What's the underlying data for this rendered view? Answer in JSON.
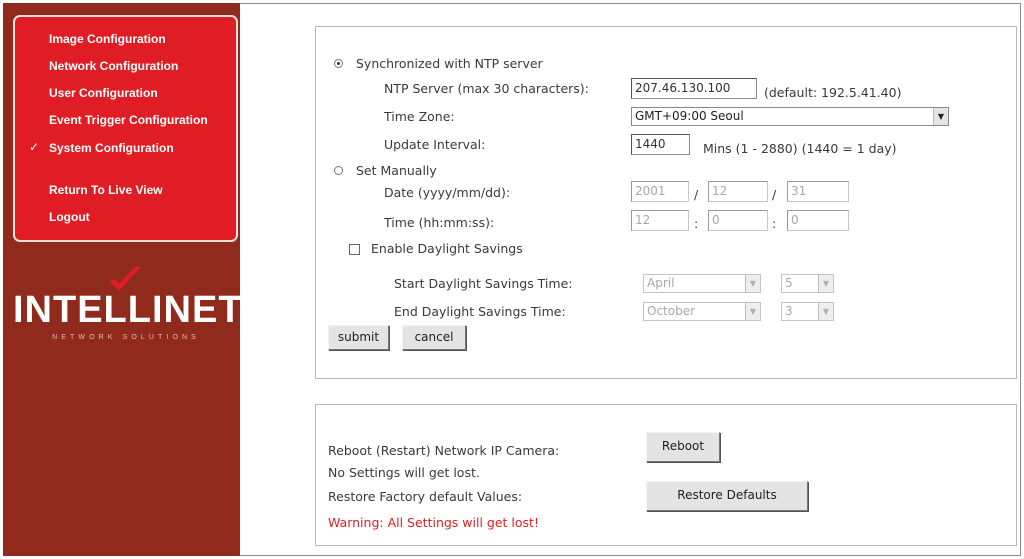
{
  "sidebar": {
    "menu": [
      {
        "label": "Image Configuration"
      },
      {
        "label": "Network Configuration"
      },
      {
        "label": "User Configuration"
      },
      {
        "label": "Event Trigger Configuration"
      },
      {
        "label": "System Configuration",
        "active": true
      },
      {
        "label": "Return To Live View"
      },
      {
        "label": "Logout"
      }
    ],
    "logo": {
      "text": "INTELLINET",
      "subtext": "NETWORK SOLUTIONS"
    }
  },
  "time_settings": {
    "ntp_option_label": "Synchronized with NTP server",
    "ntp_selected": true,
    "ntp_server_label": "NTP Server (max 30 characters):",
    "ntp_server_value": "207.46.130.100",
    "ntp_server_hint": "(default: 192.5.41.40)",
    "timezone_label": "Time Zone:",
    "timezone_value": "GMT+09:00 Seoul",
    "update_interval_label": "Update Interval:",
    "update_interval_value": "1440",
    "update_interval_hint": "Mins (1 - 2880) (1440 = 1 day)",
    "manual_option_label": "Set Manually",
    "date_label": "Date (yyyy/mm/dd):",
    "date_year": "2001",
    "date_month": "12",
    "date_day": "31",
    "date_sep": "/",
    "time_label": "Time (hh:mm:ss):",
    "time_hour": "12",
    "time_minute": "0",
    "time_second": "0",
    "time_sep": ":",
    "dst_label": "Enable Daylight Savings",
    "dst_start_label": "Start Daylight Savings Time:",
    "dst_start_month": "April",
    "dst_start_week": "5",
    "dst_end_label": "End Daylight Savings Time:",
    "dst_end_month": "October",
    "dst_end_week": "3",
    "submit_label": "submit",
    "cancel_label": "cancel"
  },
  "maintenance": {
    "reboot_label": "Reboot (Restart) Network IP Camera:",
    "reboot_note": "No Settings will get lost.",
    "reboot_button": "Reboot",
    "restore_label": "Restore Factory default Values:",
    "restore_warning": "Warning: All Settings will get lost!",
    "restore_button": "Restore Defaults"
  },
  "colors": {
    "sidebar_bg": "#8f2a1d",
    "menu_bg": "#e01c24",
    "warning": "#e02020"
  }
}
